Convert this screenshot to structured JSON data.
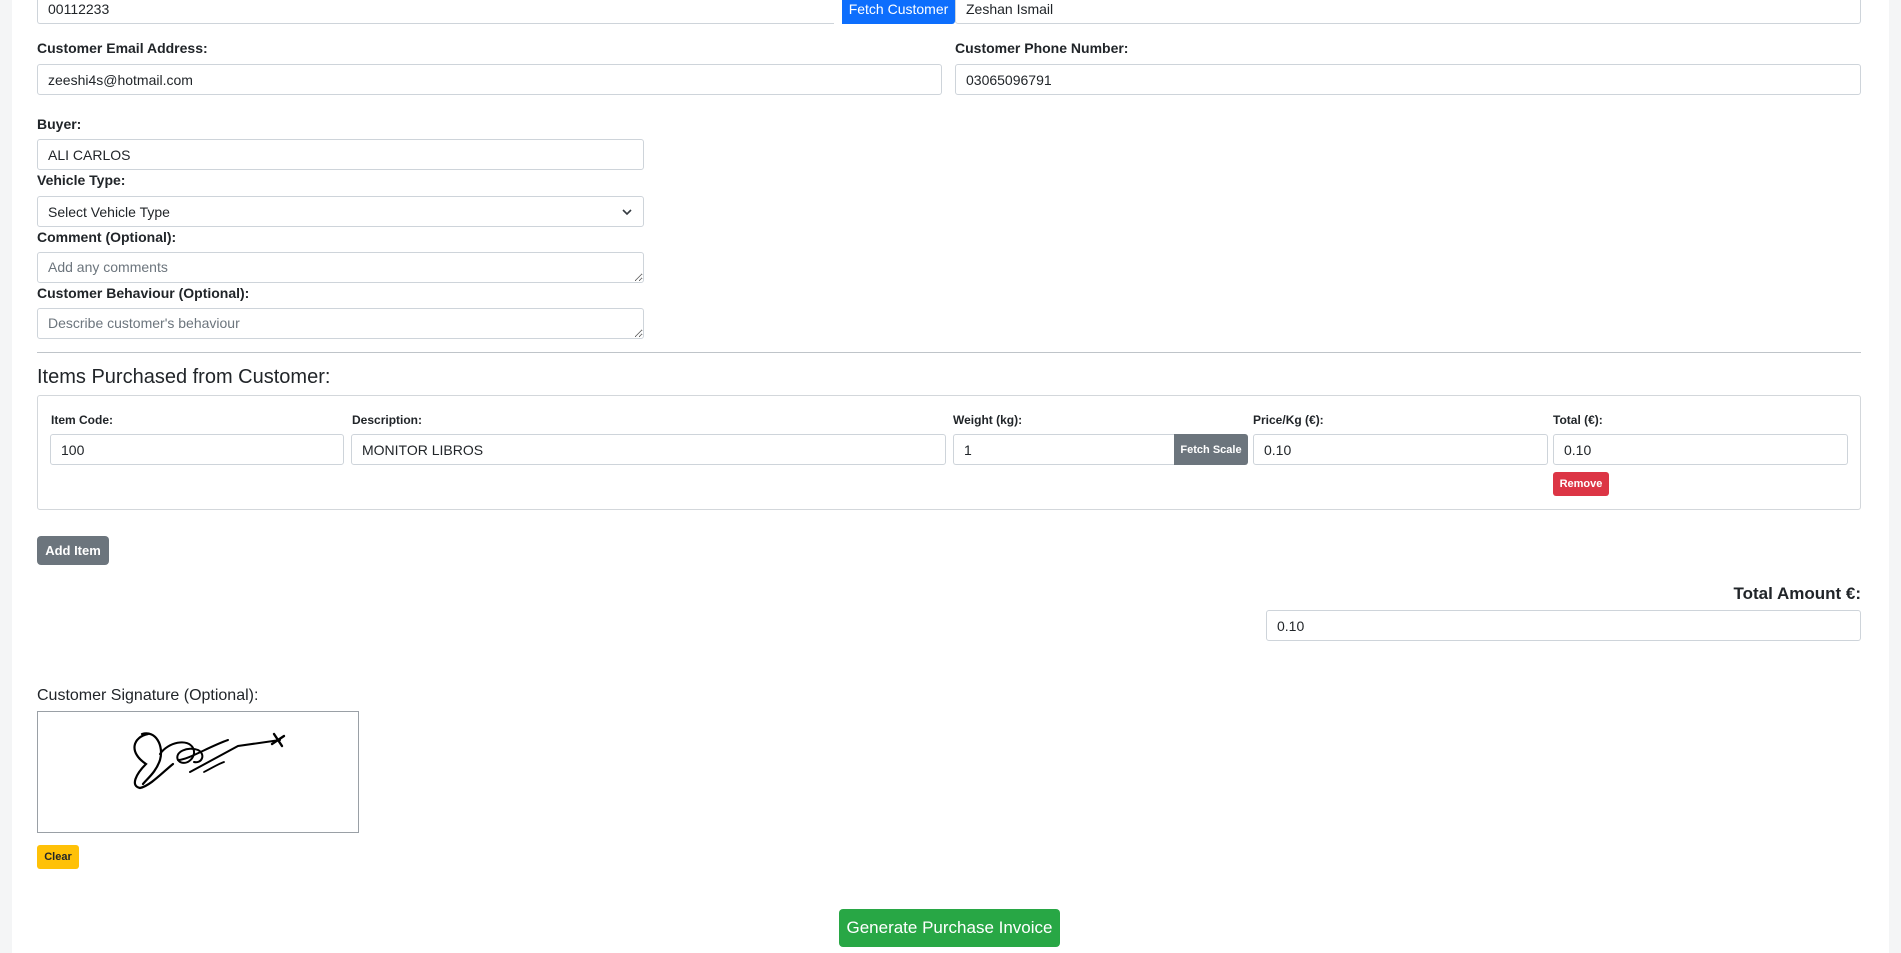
{
  "customer": {
    "id_value": "00112233",
    "fetch_button": "Fetch Customer",
    "name_value": "Zeshan Ismail",
    "email_label": "Customer Email Address:",
    "email_value": "zeeshi4s@hotmail.com",
    "phone_label": "Customer Phone Number:",
    "phone_value": "03065096791"
  },
  "buyer": {
    "label": "Buyer:",
    "value": "ALI CARLOS"
  },
  "vehicle": {
    "label": "Vehicle Type:",
    "selected": "Select Vehicle Type"
  },
  "comment": {
    "label": "Comment (Optional):",
    "placeholder": "Add any comments"
  },
  "behaviour": {
    "label": "Customer Behaviour (Optional):",
    "placeholder": "Describe customer's behaviour"
  },
  "items": {
    "heading": "Items Purchased from Customer:",
    "columns": {
      "code": "Item Code:",
      "description": "Description:",
      "weight": "Weight (kg):",
      "price": "Price/Kg (€):",
      "total": "Total (€):"
    },
    "rows": [
      {
        "code": "100",
        "description": "MONITOR LIBROS",
        "weight": "1",
        "price": "0.10",
        "total": "0.10"
      }
    ],
    "fetch_scale_button": "Fetch Scale",
    "remove_button": "Remove",
    "add_button": "Add Item"
  },
  "total": {
    "label": "Total Amount €:",
    "value": "0.10"
  },
  "signature": {
    "label": "Customer Signature (Optional):",
    "clear_button": "Clear"
  },
  "submit_button": "Generate Purchase Invoice",
  "colors": {
    "primary": "#0d6efd",
    "secondary": "#6c757d",
    "danger": "#dc3545",
    "warning": "#ffc107",
    "success": "#28a745"
  }
}
